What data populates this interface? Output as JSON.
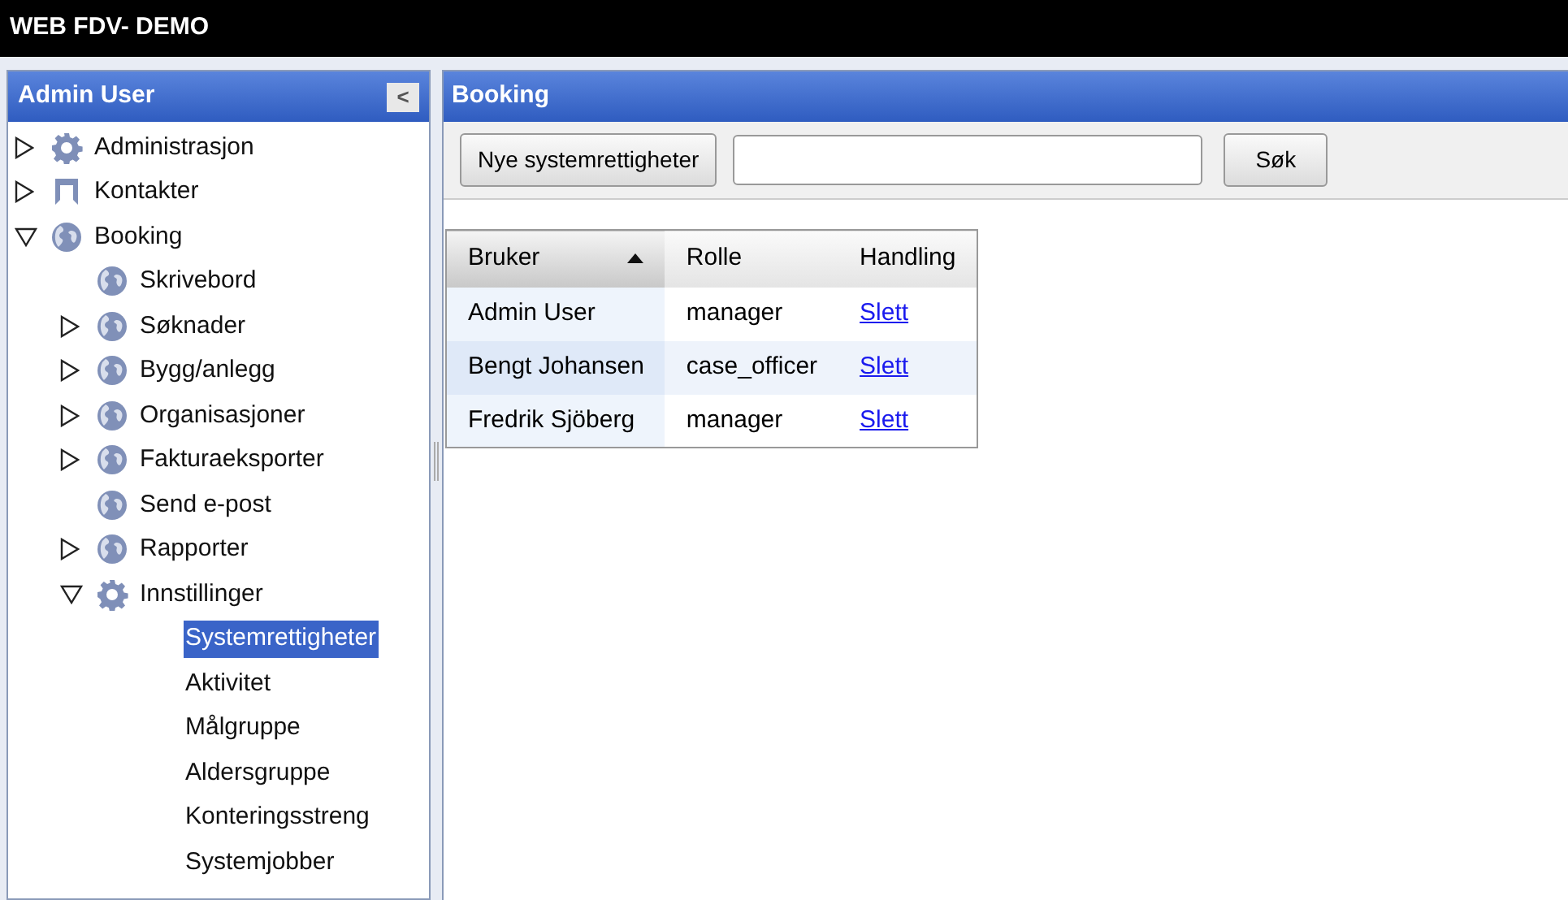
{
  "app_title": "WEB FDV- DEMO",
  "sidebar": {
    "title": "Admin User",
    "collapse_button": "<",
    "tree": [
      {
        "label": "Administrasjon",
        "kind": "gear",
        "expanded": false,
        "selected": false
      },
      {
        "label": "Kontakter",
        "kind": "contact",
        "expanded": false,
        "selected": false
      },
      {
        "label": "Booking",
        "kind": "globe",
        "expanded": true,
        "selected": false,
        "children": [
          {
            "label": "Skrivebord",
            "kind": "globe",
            "selected": false
          },
          {
            "label": "Søknader",
            "kind": "globe",
            "expanded": false,
            "selected": false
          },
          {
            "label": "Bygg/anlegg",
            "kind": "globe",
            "expanded": false,
            "selected": false
          },
          {
            "label": "Organisasjoner",
            "kind": "globe",
            "expanded": false,
            "selected": false
          },
          {
            "label": "Fakturaeksporter",
            "kind": "globe",
            "expanded": false,
            "selected": false
          },
          {
            "label": "Send e-post",
            "kind": "globe",
            "selected": false
          },
          {
            "label": "Rapporter",
            "kind": "globe",
            "expanded": false,
            "selected": false
          },
          {
            "label": "Innstillinger",
            "kind": "gear",
            "expanded": true,
            "selected": false,
            "children": [
              {
                "label": "Systemrettigheter",
                "selected": true
              },
              {
                "label": "Aktivitet",
                "selected": false
              },
              {
                "label": "Målgruppe",
                "selected": false
              },
              {
                "label": "Aldersgruppe",
                "selected": false
              },
              {
                "label": "Konteringsstreng",
                "selected": false
              },
              {
                "label": "Systemjobber",
                "selected": false
              }
            ]
          }
        ]
      }
    ]
  },
  "main": {
    "title": "Booking",
    "new_button": "Nye systemrettigheter",
    "search_button": "Søk",
    "table": {
      "columns": [
        {
          "label": "Bruker",
          "sorted": true
        },
        {
          "label": "Rolle",
          "sorted": false
        },
        {
          "label": "Handling",
          "sorted": false
        }
      ],
      "rows": [
        {
          "user": "Admin User",
          "role": "manager",
          "action": "Slett"
        },
        {
          "user": "Bengt Johansen",
          "role": "case_officer",
          "action": "Slett"
        },
        {
          "user": "Fredrik Sjöberg",
          "role": "manager",
          "action": "Slett"
        }
      ]
    }
  }
}
